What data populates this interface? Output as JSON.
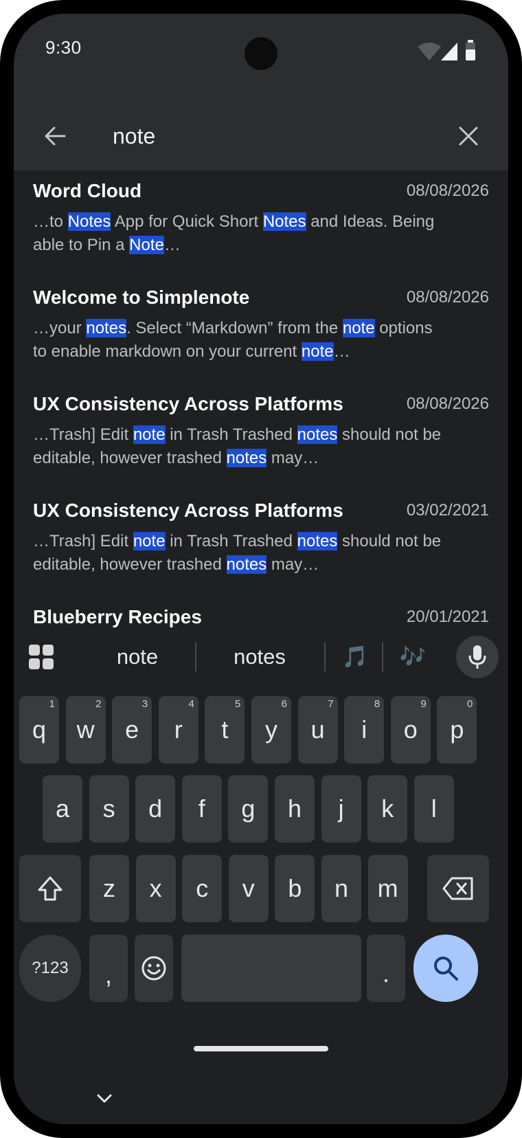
{
  "status_bar": {
    "time": "9:30"
  },
  "search": {
    "query": "note"
  },
  "results": [
    {
      "title": "Word Cloud",
      "date": "08/08/2026",
      "line1": [
        {
          "t": "…to "
        },
        {
          "t": "Notes",
          "hl": true
        },
        {
          "t": " App for Quick Short "
        },
        {
          "t": "Notes",
          "hl": true
        },
        {
          "t": " and Ideas. Being"
        }
      ],
      "line2": [
        {
          "t": "able to Pin a "
        },
        {
          "t": "Note",
          "hl": true
        },
        {
          "t": "…"
        }
      ]
    },
    {
      "title": "Welcome to Simplenote",
      "date": "08/08/2026",
      "line1": [
        {
          "t": "…your "
        },
        {
          "t": "notes",
          "hl": true
        },
        {
          "t": ". Select “Markdown” from the "
        },
        {
          "t": "note",
          "hl": true
        },
        {
          "t": " options"
        }
      ],
      "line2": [
        {
          "t": "to enable markdown on your current "
        },
        {
          "t": "note",
          "hl": true
        },
        {
          "t": "…"
        }
      ]
    },
    {
      "title": "UX Consistency Across Platforms",
      "date": "08/08/2026",
      "line1": [
        {
          "t": "…Trash] Edit "
        },
        {
          "t": "note",
          "hl": true
        },
        {
          "t": " in Trash  Trashed "
        },
        {
          "t": "notes",
          "hl": true
        },
        {
          "t": " should not be"
        }
      ],
      "line2": [
        {
          "t": "editable, however trashed "
        },
        {
          "t": "notes",
          "hl": true
        },
        {
          "t": " may…"
        }
      ]
    },
    {
      "title": "UX Consistency Across Platforms",
      "date": "03/02/2021",
      "line1": [
        {
          "t": "…Trash] Edit "
        },
        {
          "t": "note",
          "hl": true
        },
        {
          "t": " in Trash  Trashed "
        },
        {
          "t": "notes",
          "hl": true
        },
        {
          "t": " should not be"
        }
      ],
      "line2": [
        {
          "t": "editable, however trashed "
        },
        {
          "t": "notes",
          "hl": true
        },
        {
          "t": " may…"
        }
      ]
    },
    {
      "title": "Blueberry Recipes",
      "date": "20/01/2021",
      "line1": [],
      "line2": []
    }
  ],
  "keyboard": {
    "suggestions": [
      "note",
      "notes",
      "🎵",
      "🎶"
    ],
    "row1": [
      {
        "k": "q",
        "h": "1"
      },
      {
        "k": "w",
        "h": "2"
      },
      {
        "k": "e",
        "h": "3"
      },
      {
        "k": "r",
        "h": "4"
      },
      {
        "k": "t",
        "h": "5"
      },
      {
        "k": "y",
        "h": "6"
      },
      {
        "k": "u",
        "h": "7"
      },
      {
        "k": "i",
        "h": "8"
      },
      {
        "k": "o",
        "h": "9"
      },
      {
        "k": "p",
        "h": "0"
      }
    ],
    "row2": [
      "a",
      "s",
      "d",
      "f",
      "g",
      "h",
      "j",
      "k",
      "l"
    ],
    "row3": [
      "z",
      "x",
      "c",
      "v",
      "b",
      "n",
      "m"
    ],
    "symbols_label": "?123",
    "comma": ",",
    "period": ".",
    "icons": {
      "apps": "apps-grid-icon",
      "mic": "microphone-icon",
      "shift": "shift-icon",
      "backspace": "backspace-icon",
      "emoji": "emoji-icon",
      "search": "search-icon",
      "hide": "chevron-down-icon"
    }
  },
  "colors": {
    "background": "#1f2022",
    "app_bar": "#2c2d2f",
    "highlight": "#1f4fce",
    "key": "#3a3b3d",
    "search_key": "#a8c7fa"
  }
}
